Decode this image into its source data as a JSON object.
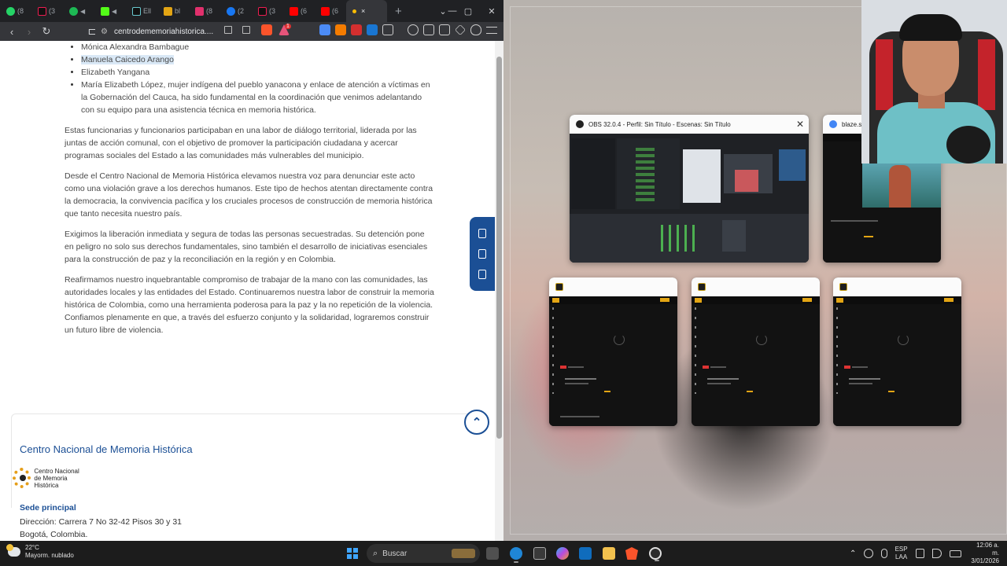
{
  "browser": {
    "tabs": [
      {
        "label": "(8",
        "color": "#25d366"
      },
      {
        "label": "(3",
        "color": "#111111"
      },
      {
        "label": "",
        "color": "#1db954"
      },
      {
        "label": "",
        "color": "#53fc18"
      },
      {
        "label": "Ell",
        "color": "#111111"
      },
      {
        "label": "bl",
        "color": "#e3a514"
      },
      {
        "label": "(8",
        "color": "#e1306c"
      },
      {
        "label": "(2",
        "color": "#1877f2"
      },
      {
        "label": "(3",
        "color": "#111111"
      },
      {
        "label": "(6",
        "color": "#ff0000"
      },
      {
        "label": "(6",
        "color": "#ff0000"
      }
    ],
    "active_tab_close": "×",
    "new_tab": "+",
    "url": "centrodememoriahistorica....",
    "brave_badge": "1"
  },
  "article": {
    "names": [
      "Mónica Alexandra Bambague",
      "Manuela Caicedo Arango",
      "Elizabeth Yangana",
      "María Elizabeth López, mujer indígena del pueblo yanacona y enlace de atención a víctimas en la Gobernación del Cauca, ha sido fundamental en la coordinación que venimos adelantando con su equipo para una asistencia técnica en memoria histórica."
    ],
    "paragraphs": [
      "Estas funcionarias y funcionarios participaban en una labor de diálogo territorial, liderada por las juntas de acción comunal, con el objetivo de promover la participación ciudadana y acercar programas sociales del Estado a las comunidades más vulnerables del municipio.",
      "Desde el Centro Nacional de Memoria Histórica elevamos nuestra voz para denunciar este acto como una violación grave a los derechos humanos. Este tipo de hechos atentan directamente contra la democracia, la convivencia pacífica y los cruciales procesos de construcción de memoria histórica que tanto necesita nuestro país.",
      "Exigimos la liberación inmediata y segura de todas las personas secuestradas. Su detención pone en peligro no solo sus derechos fundamentales, sino también el desarrollo de iniciativas esenciales para la construcción de paz y la reconciliación en la región y en Colombia.",
      "Reafirmamos nuestro inquebrantable compromiso de trabajar de la mano con las comunidades, las autoridades locales y las entidades del Estado. Continuaremos nuestra labor de construir la memoria histórica de Colombia, como una herramienta poderosa para la paz y la no repetición de la violencia. Confiamos plenamente en que, a través del esfuerzo conjunto y la solidaridad, lograremos construir un futuro libre de violencia."
    ]
  },
  "footer": {
    "title": "Centro Nacional de Memoria Histórica",
    "logo_line1": "Centro Nacional",
    "logo_line2": "de Memoria Histórica",
    "sede_label": "Sede principal",
    "address": "Dirección: Carrera 7 No 32-42 Pisos 30 y 31",
    "city": "Bogotá, Colombia."
  },
  "switcher": {
    "obs_title": "OBS 32.0.4 - Perfil: Sin Título - Escenas: Sin Título",
    "blaze_title": "blaze.st",
    "close": "✕"
  },
  "taskbar": {
    "temperature": "22°C",
    "weather": "Mayorm. nublado",
    "search": "Buscar",
    "lang1": "ESP",
    "lang2": "LAA",
    "time": "12:06 a. m.",
    "date": "3/01/2026"
  },
  "colors": {
    "accent": "#1b4f95",
    "blaze_yellow": "#e3a514"
  }
}
